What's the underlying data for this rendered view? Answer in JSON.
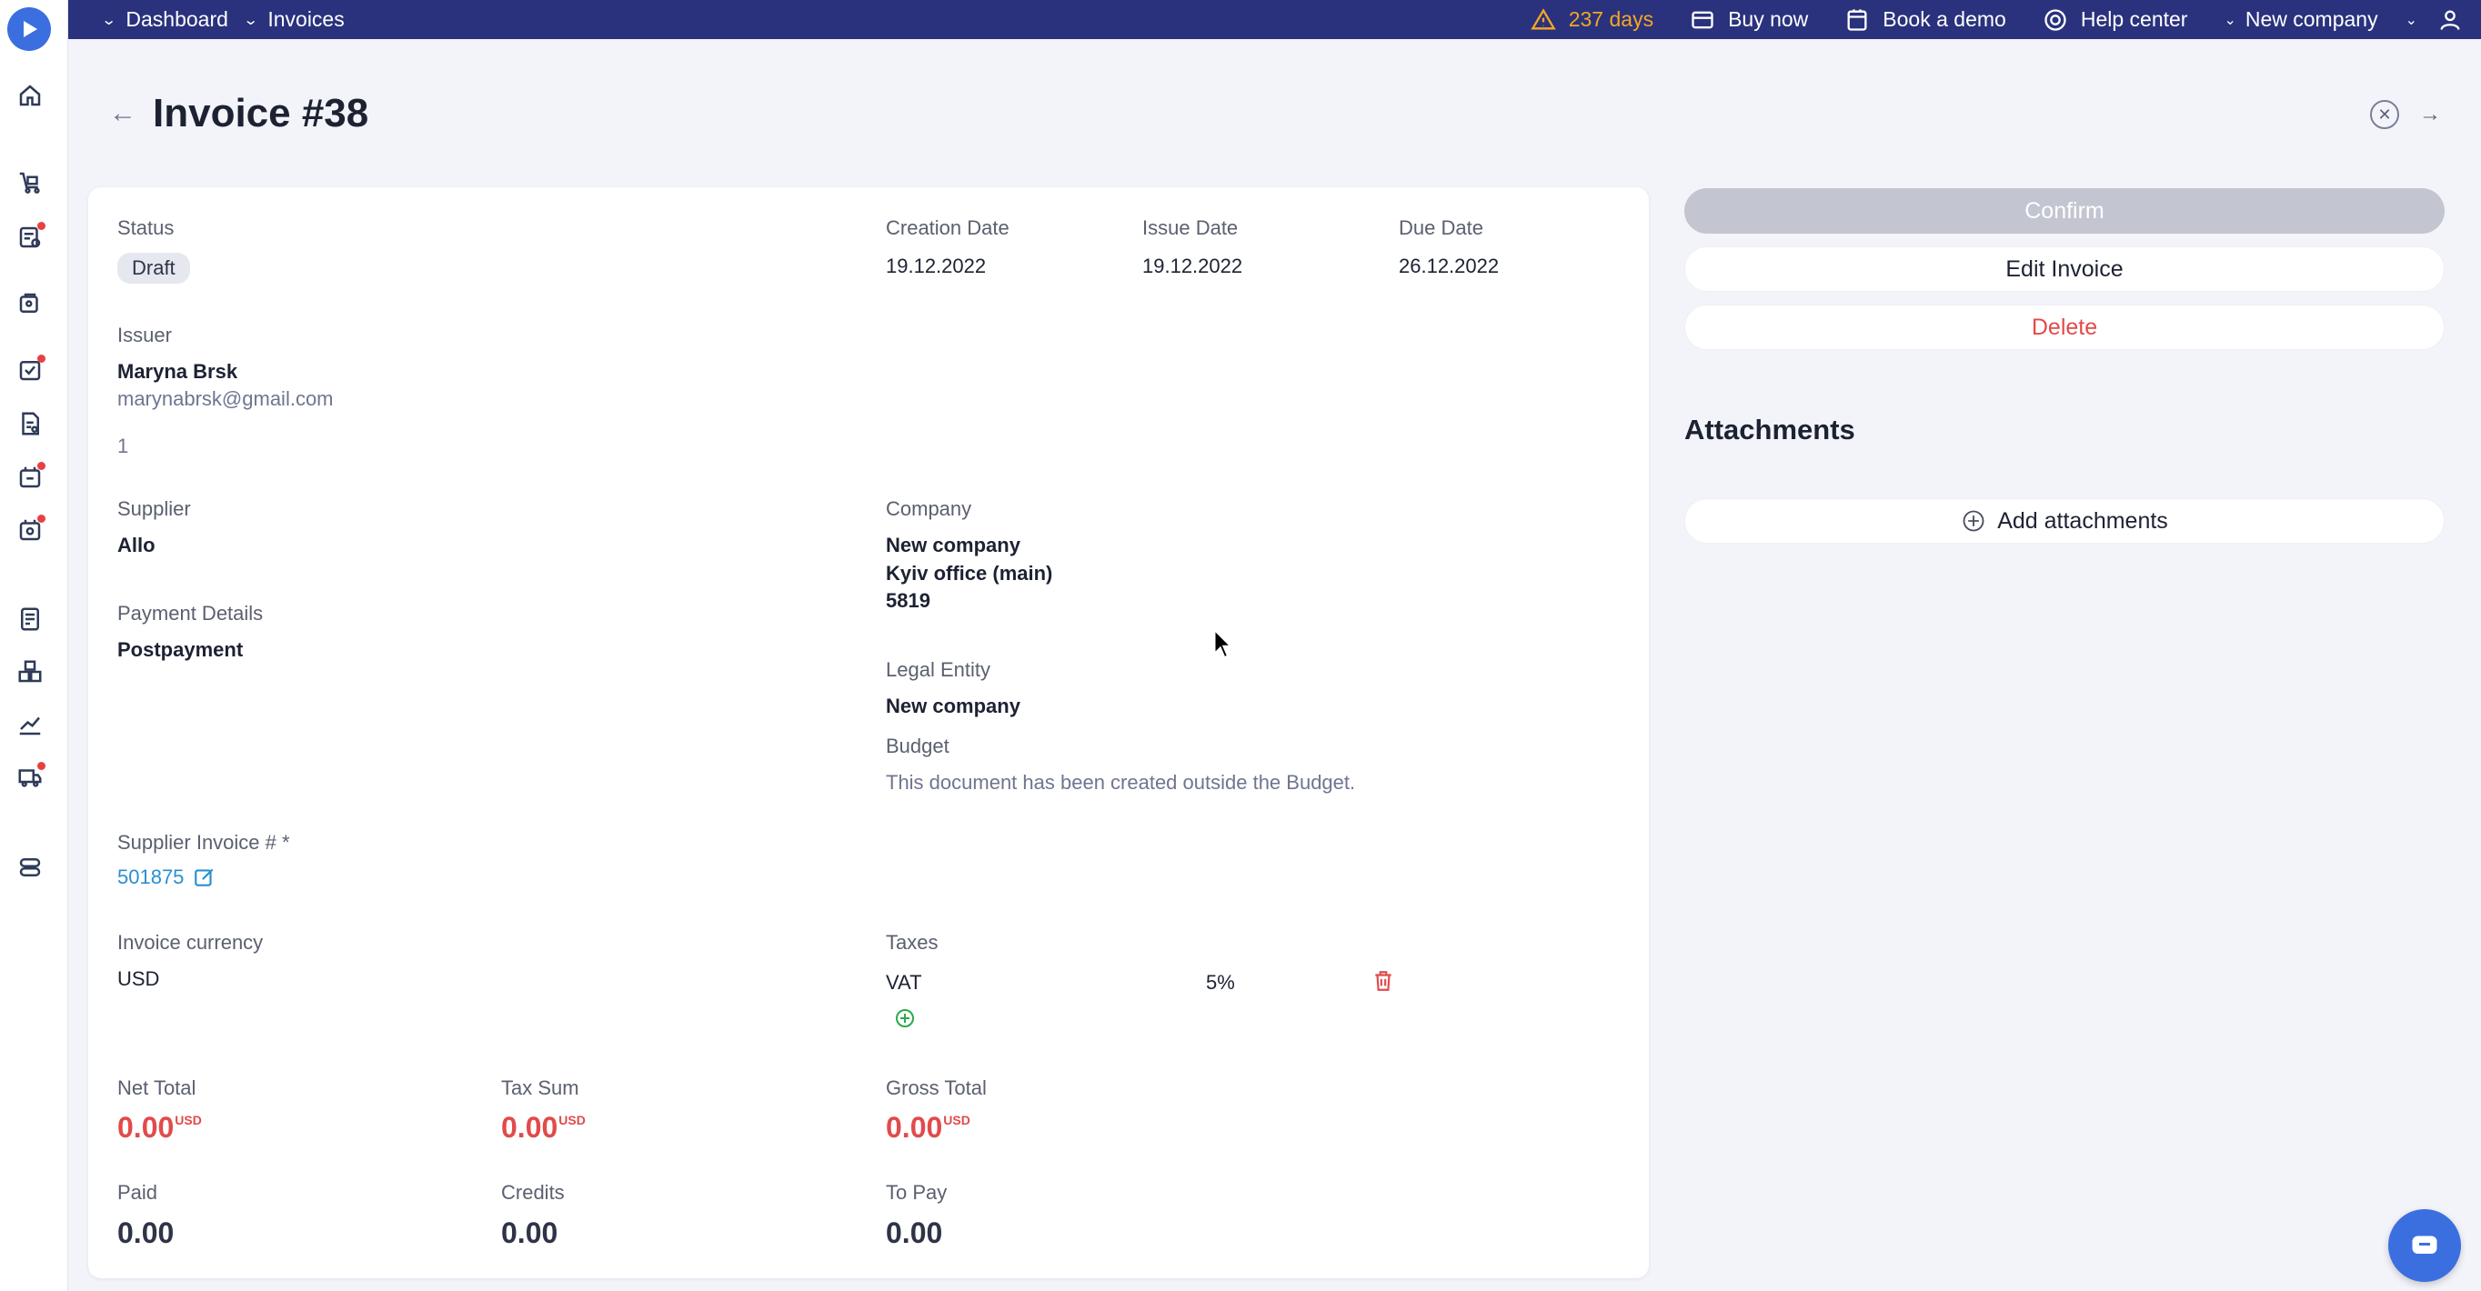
{
  "topbar": {
    "dashboard": "Dashboard",
    "invoices": "Invoices",
    "days": "237 days",
    "buy_now": "Buy now",
    "book_demo": "Book a demo",
    "help_center": "Help center",
    "company": "New company"
  },
  "page": {
    "title": "Invoice #38"
  },
  "invoice": {
    "status_label": "Status",
    "status_value": "Draft",
    "creation_label": "Creation Date",
    "creation_value": "19.12.2022",
    "issue_label": "Issue Date",
    "issue_value": "19.12.2022",
    "due_label": "Due Date",
    "due_value": "26.12.2022",
    "issuer_label": "Issuer",
    "issuer_name": "Maryna Brsk",
    "issuer_email": "marynabrsk@gmail.com",
    "issuer_extra": "1",
    "supplier_label": "Supplier",
    "supplier_value": "Allo",
    "company_label": "Company",
    "company_line1": "New company",
    "company_line2": "Kyiv office (main)",
    "company_line3": "5819",
    "payment_label": "Payment Details",
    "payment_value": "Postpayment",
    "legal_label": "Legal Entity",
    "legal_value": "New company",
    "budget_label": "Budget",
    "budget_value": "This document has been created outside the Budget.",
    "supplier_invoice_label": "Supplier Invoice # *",
    "supplier_invoice_value": "501875",
    "currency_label": "Invoice currency",
    "currency_value": "USD",
    "taxes_label": "Taxes",
    "tax_name": "VAT",
    "tax_rate": "5%",
    "net_total_label": "Net Total",
    "net_total_value": "0.00",
    "tax_sum_label": "Tax Sum",
    "tax_sum_value": "0.00",
    "gross_total_label": "Gross Total",
    "gross_total_value": "0.00",
    "unit": "USD",
    "paid_label": "Paid",
    "paid_value": "0.00",
    "credits_label": "Credits",
    "credits_value": "0.00",
    "to_pay_label": "To Pay",
    "to_pay_value": "0.00"
  },
  "actions": {
    "confirm": "Confirm",
    "edit": "Edit Invoice",
    "delete": "Delete",
    "attachments_title": "Attachments",
    "add_attachments": "Add attachments"
  },
  "colors": {
    "topbar": "#2a327d",
    "accent_blue": "#3b6fe0",
    "danger": "#e14b4b",
    "warning": "#f5a623",
    "link": "#2a8fd0"
  }
}
